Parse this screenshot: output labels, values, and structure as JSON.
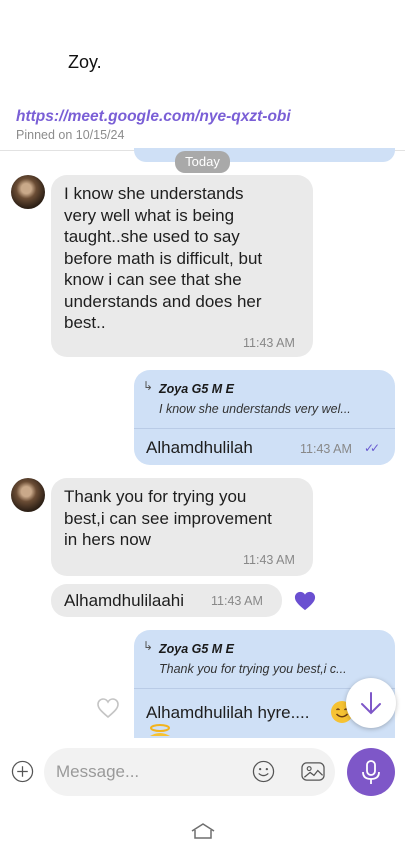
{
  "header": {
    "title": "Zoy."
  },
  "pinned": {
    "link": "https://meet.google.com/nye-qxzt-obi",
    "date_label": "Pinned on 10/15/24"
  },
  "divider": {
    "today": "Today"
  },
  "messages": [
    {
      "direction": "incoming",
      "lines": [
        "I know she understands",
        "very well what is being",
        "taught..she used to say",
        "before math is difficult, but",
        "know i can see that she",
        "understands and does her",
        "best.."
      ],
      "time": "11:43 AM"
    },
    {
      "direction": "outgoing",
      "reply": {
        "name": "Zoya G5 M E",
        "snippet": "I know she understands very wel..."
      },
      "text": "Alhamdhulilah",
      "time": "11:43 AM",
      "status": "read"
    },
    {
      "direction": "incoming",
      "lines": [
        "Thank you for trying you",
        "best,i can see improvement",
        "in hers now"
      ],
      "time": "11:43 AM"
    },
    {
      "direction": "incoming",
      "text": "Alhamdhulilaahi",
      "time": "11:43 AM",
      "reaction": "heart"
    },
    {
      "direction": "outgoing",
      "reply": {
        "name": "Zoya G5 M E",
        "snippet": "Thank you for trying you best,i c..."
      },
      "text": "Alhamdhulilah hyre...."
    }
  ],
  "composer": {
    "placeholder": "Message..."
  },
  "colors": {
    "accent": "#7e57c8",
    "outgoing_bubble": "#cfe0f6",
    "incoming_bubble": "#eaeaea",
    "link": "#7a5fd6"
  },
  "icons": [
    "add-icon",
    "emoji-icon",
    "sticker-icon",
    "microphone-icon",
    "chevron-down-icon",
    "heart-icon",
    "home-icon"
  ]
}
